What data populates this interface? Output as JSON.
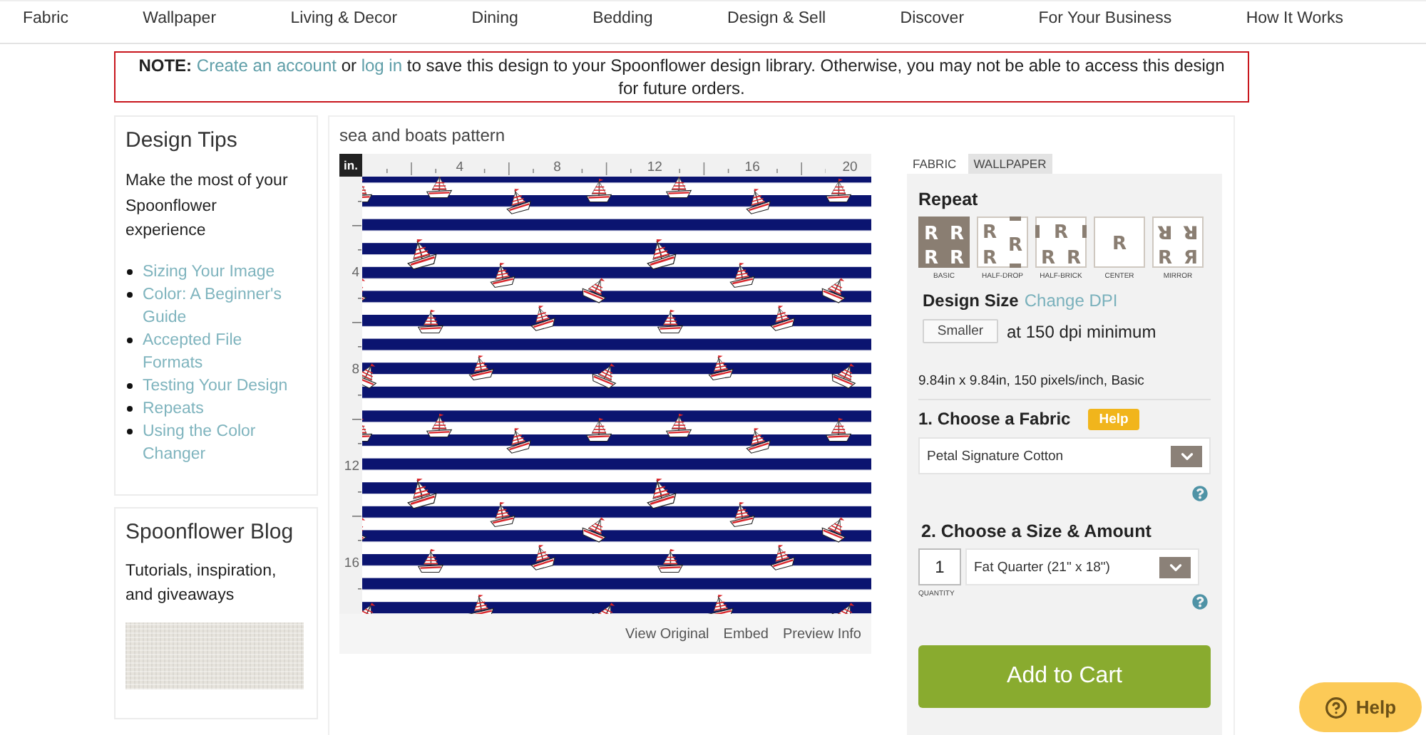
{
  "nav": {
    "items": [
      "Fabric",
      "Wallpaper",
      "Living & Decor",
      "Dining",
      "Bedding",
      "Design & Sell",
      "Discover",
      "For Your Business",
      "How It Works"
    ]
  },
  "notice": {
    "label": "NOTE:",
    "segments": [
      {
        "kind": "link",
        "text": "Create an account"
      },
      {
        "kind": "text",
        "text": "or"
      },
      {
        "kind": "link",
        "text": "log in"
      },
      {
        "kind": "text",
        "text": "to save this design to your Spoonflower design library. Otherwise, you may not be able to access this design for future orders."
      }
    ]
  },
  "design_tips": {
    "title": "Design Tips",
    "intro": "Make the most of your Spoonflower experience",
    "links": [
      "Sizing Your Image",
      "Color: A Beginner's Guide",
      "Accepted File Formats",
      "Testing Your Design",
      "Repeats",
      "Using the Color Changer"
    ]
  },
  "blog": {
    "title": "Spoonflower Blog",
    "intro": "Tutorials, inspiration, and giveaways"
  },
  "design": {
    "title": "sea and boats pattern",
    "ruler": {
      "unit": "in.",
      "top_labels": [
        "4",
        "8",
        "12",
        "16",
        "20"
      ],
      "side_labels": [
        "4",
        "8",
        "12",
        "16"
      ]
    },
    "links": [
      "View Original",
      "Embed",
      "Preview Info"
    ]
  },
  "product_tabs": [
    {
      "label": "FABRIC",
      "selected": true
    },
    {
      "label": "WALLPAPER",
      "selected": false
    }
  ],
  "repeat": {
    "title": "Repeat",
    "options": [
      {
        "kind": "basic",
        "glyphs": [
          "R",
          "R",
          "R",
          "R"
        ],
        "label": "BASIC",
        "selected": true
      },
      {
        "kind": "half_drop",
        "glyphs": [
          "R",
          "R",
          "R"
        ],
        "label": "HALF-DROP",
        "selected": false
      },
      {
        "kind": "half_brick",
        "glyphs": [
          "R",
          "R",
          "R"
        ],
        "label": "HALF-BRICK",
        "selected": false
      },
      {
        "kind": "center",
        "glyphs": [
          "R"
        ],
        "label": "CENTER",
        "selected": false
      },
      {
        "kind": "mirror",
        "glyphs": [
          "ᴚ",
          "ᴚ",
          "R",
          "Я"
        ],
        "label": "MIRROR",
        "selected": false
      }
    ]
  },
  "design_size": {
    "title": "Design Size",
    "link": "Change DPI",
    "button": "Smaller",
    "note": "at 150 dpi minimum",
    "summary": "9.84in x 9.84in, 150 pixels/inch, Basic"
  },
  "fabric": {
    "title": "1. Choose a Fabric",
    "help": "Help",
    "select": "Petal Signature Cotton"
  },
  "size": {
    "title": "2. Choose a Size & Amount",
    "quantity": "1",
    "quantity_label": "QUANTITY",
    "select": "Fat Quarter (21\" x 18\")"
  },
  "add_to_cart": "Add to Cart",
  "help_button": "Help"
}
